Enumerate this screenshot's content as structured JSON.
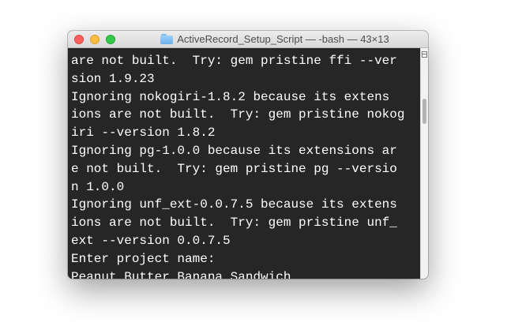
{
  "window": {
    "title": "ActiveRecord_Setup_Script — -bash — 43×13"
  },
  "terminal": {
    "lines": [
      "are not built.  Try: gem pristine ffi --ver",
      "sion 1.9.23",
      "Ignoring nokogiri-1.8.2 because its extens",
      "ions are not built.  Try: gem pristine nokog",
      "iri --version 1.8.2",
      "Ignoring pg-1.0.0 because its extensions ar",
      "e not built.  Try: gem pristine pg --versio",
      "n 1.0.0",
      "Ignoring unf_ext-0.0.7.5 because its extens",
      "ions are not built.  Try: gem pristine unf_",
      "ext --version 0.0.7.5",
      "Enter project name:",
      "Peanut_Butter_Banana_Sandwich"
    ]
  },
  "colors": {
    "terminal_background": "#262626",
    "terminal_text": "#ffffff",
    "close": "#fc605c",
    "minimize": "#fdbc40",
    "zoom": "#34c84a"
  },
  "icons": {
    "title_icon": "folder-icon",
    "scroll_control": "split-pane-icon"
  },
  "scrollbar": {
    "thumb_position_fraction": 0.3
  }
}
